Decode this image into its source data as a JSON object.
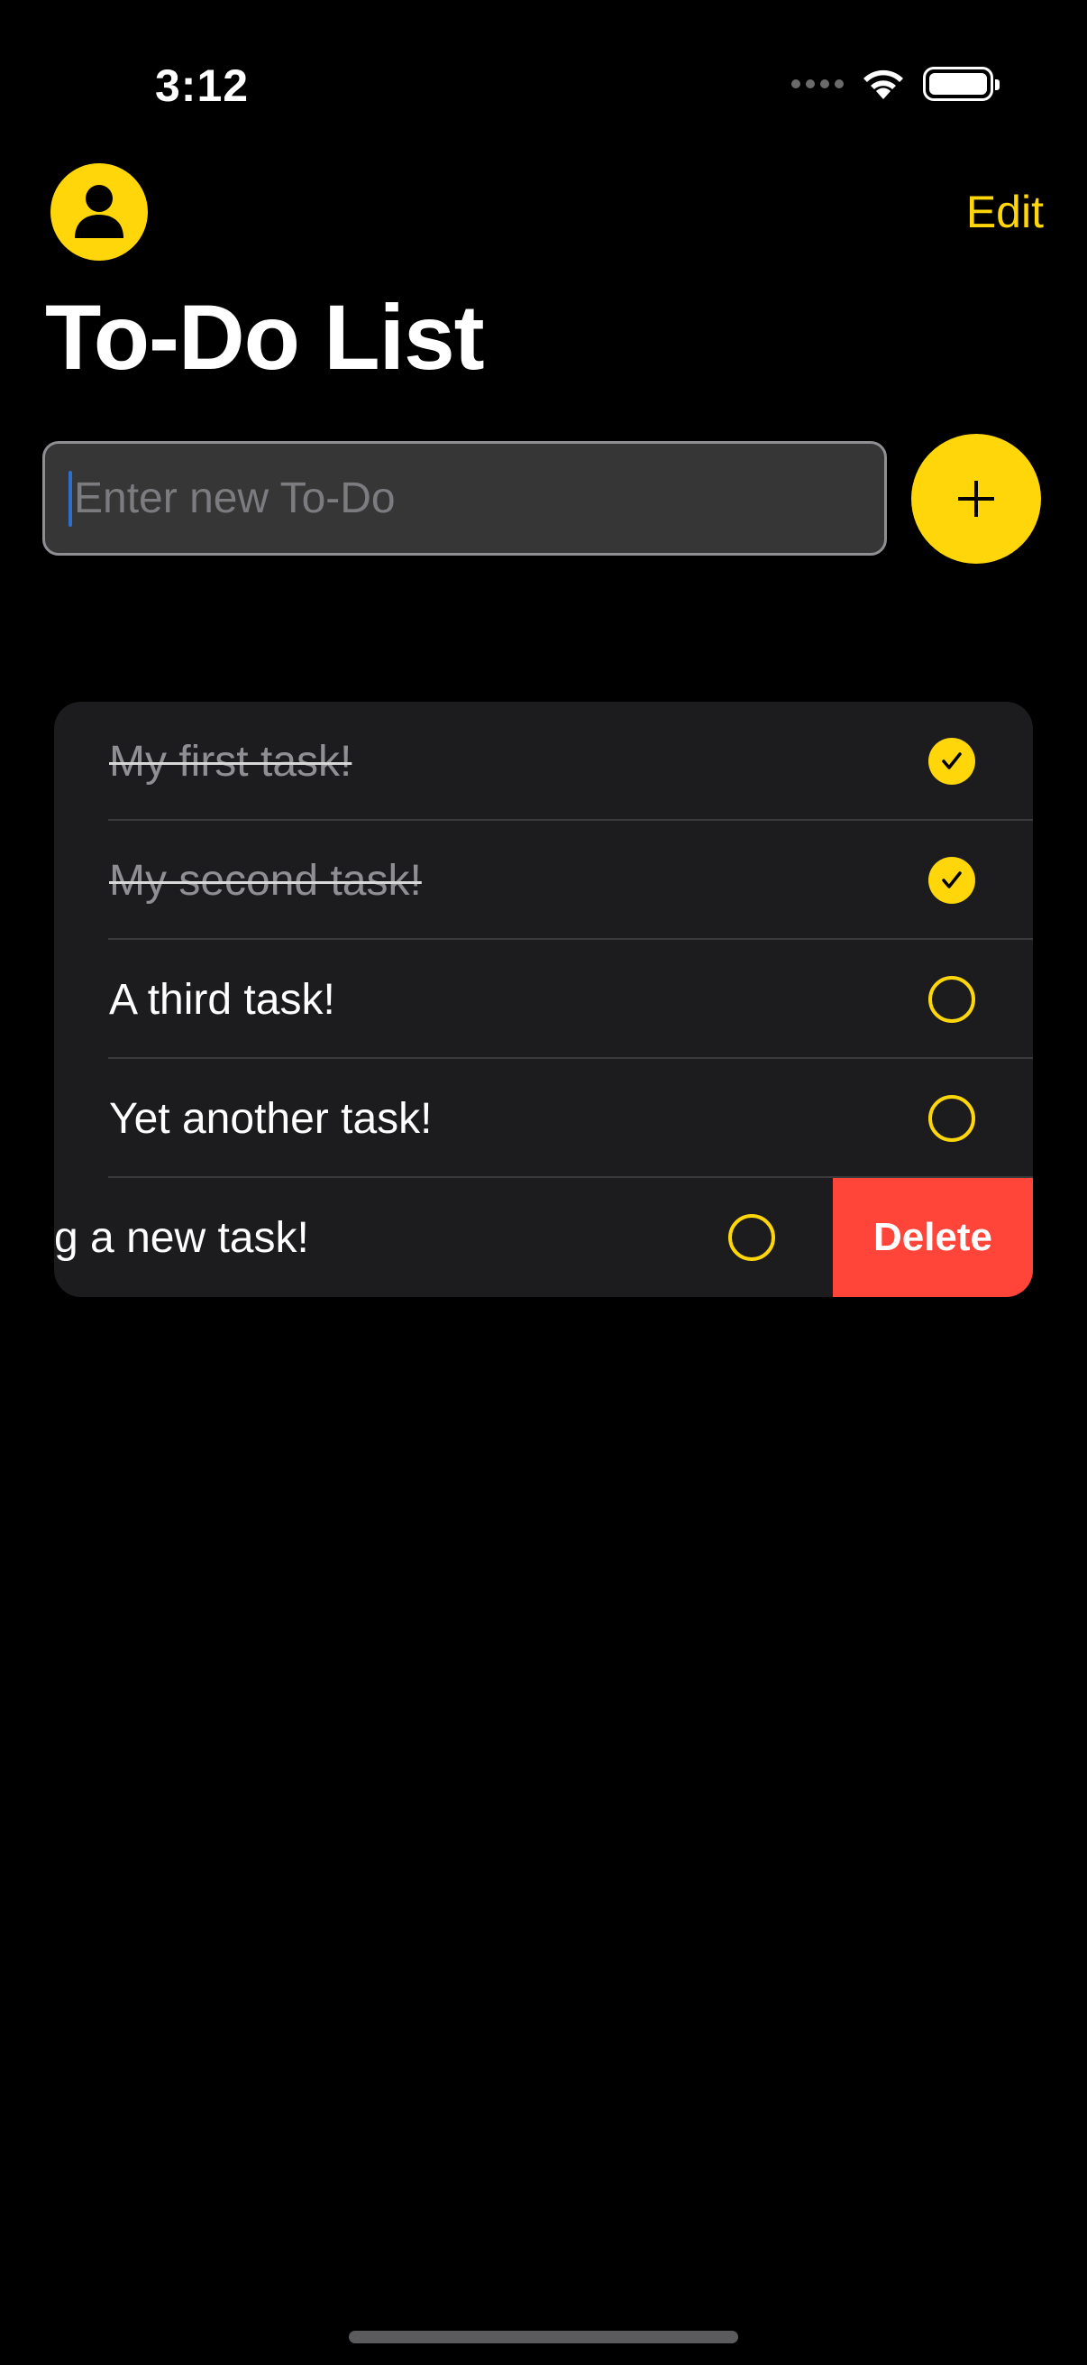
{
  "status_bar": {
    "time": "3:12",
    "icons": [
      "cellular-signal-icon",
      "wifi-icon",
      "battery-icon"
    ]
  },
  "header": {
    "avatar_icon": "person-circle-icon",
    "edit_label": "Edit",
    "title": "To-Do List"
  },
  "new_todo": {
    "placeholder": "Enter new To-Do",
    "value": "",
    "add_icon": "plus-icon"
  },
  "todos": [
    {
      "label": "My first task!",
      "completed": true
    },
    {
      "label": "My second task!",
      "completed": true
    },
    {
      "label": "A third task!",
      "completed": false
    },
    {
      "label": "Yet another task!",
      "completed": false
    },
    {
      "label": "g a new task!",
      "completed": false,
      "swiped": true
    }
  ],
  "swipe_action": {
    "label": "Delete"
  },
  "colors": {
    "accent": "#ffd60a",
    "background": "#000000",
    "list_background": "#1c1c1e",
    "destructive": "#ff453a",
    "field_background": "#363636"
  }
}
